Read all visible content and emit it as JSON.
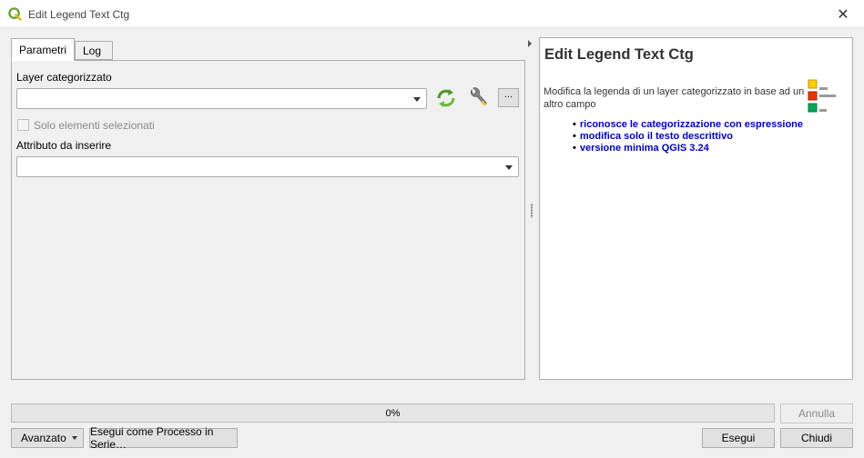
{
  "window": {
    "title": "Edit Legend Text Ctg",
    "close_glyph": "✕",
    "app_icon": "qgis-logo-icon"
  },
  "tabs": [
    {
      "label": "Parametri",
      "active": true
    },
    {
      "label": "Log",
      "active": false
    }
  ],
  "params": {
    "layer_label": "Layer categorizzato",
    "layer_value": "",
    "selected_only_label": "Solo elementi selezionati",
    "selected_only_checked": false,
    "attribute_label": "Attributo da inserire",
    "attribute_value": "",
    "dots_label": "…",
    "icons": [
      "refresh-icon",
      "wrench-icon"
    ]
  },
  "help": {
    "title": "Edit Legend Text Ctg",
    "description": "Modifica la legenda di un layer categorizzato in base ad un altro campo",
    "items": [
      "riconosce le categorizzazione con espressione",
      "modifica solo il testo descrittivo",
      "versione minima QGIS 3.24"
    ],
    "graphic": "legend-icon",
    "colors": {
      "link": "#0000cc",
      "square1": "#ffcc00",
      "square2": "#ee3300",
      "square3": "#00aa55"
    }
  },
  "footer": {
    "progress_text": "0%",
    "progress_value": 0,
    "cancel_label": "Annulla",
    "advanced_label": "Avanzato",
    "batch_label": "Esegui come Processo in Serie…",
    "run_label": "Esegui",
    "close_label": "Chiudi"
  }
}
